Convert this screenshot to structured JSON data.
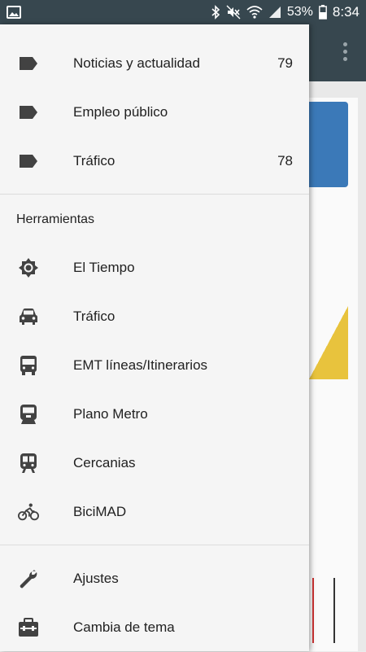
{
  "statusbar": {
    "battery": "53%",
    "time": "8:34",
    "icons": [
      "image-icon",
      "bluetooth-icon",
      "mute-icon",
      "wifi-icon",
      "signal-icon",
      "battery-icon"
    ]
  },
  "drawer": {
    "tags": [
      {
        "label": "Noticias y actualidad",
        "count": "79",
        "icon": "tag-icon"
      },
      {
        "label": "Empleo público",
        "count": "",
        "icon": "tag-icon"
      },
      {
        "label": "Tráfico",
        "count": "78",
        "icon": "tag-icon"
      }
    ],
    "tools_header": "Herramientas",
    "tools": [
      {
        "label": "El Tiempo",
        "icon": "weather-sun-icon"
      },
      {
        "label": "Tráfico",
        "icon": "car-icon"
      },
      {
        "label": "EMT líneas/Itinerarios",
        "icon": "bus-icon"
      },
      {
        "label": "Plano Metro",
        "icon": "metro-icon"
      },
      {
        "label": "Cercanias",
        "icon": "train-icon"
      },
      {
        "label": "BiciMAD",
        "icon": "bike-icon"
      }
    ],
    "settings": [
      {
        "label": "Ajustes",
        "icon": "wrench-icon"
      },
      {
        "label": "Cambia de tema",
        "icon": "toolbox-icon"
      }
    ]
  },
  "colors": {
    "statusbar": "#37474f",
    "drawer_bg": "#f5f5f5",
    "icon": "#424242",
    "text": "#212121"
  }
}
